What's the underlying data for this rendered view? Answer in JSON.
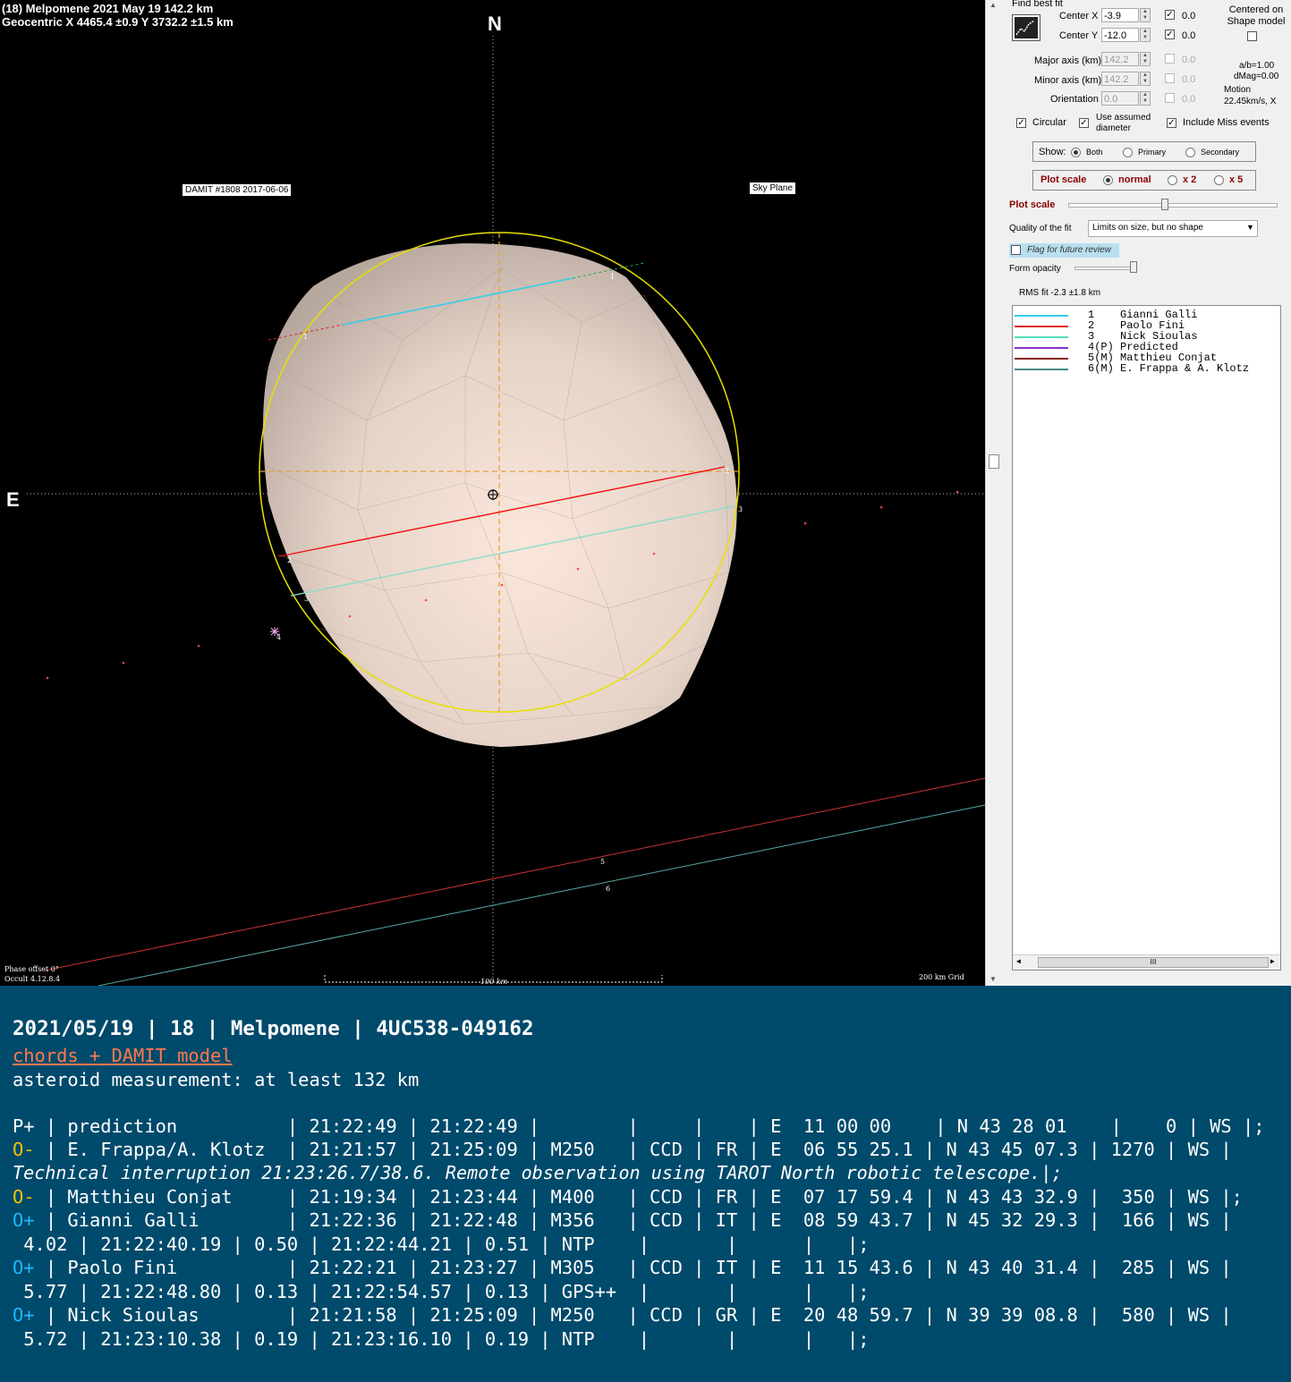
{
  "plot": {
    "header_line1": "(18) Melpomene  2021 May 19   142.2 km",
    "header_line2": "Geocentric X  4465.4 ±0.9  Y 3732.2 ±1.5 km",
    "north": "N",
    "east": "E",
    "model_label": "DAMIT #1808 2017-06-06",
    "view_label": "Sky Plane",
    "phase_offset": "Phase offset 0°",
    "version": "Occult 4.12.8.4",
    "scale_bar": "100 km",
    "grid": "200 km Grid",
    "chord_labels": [
      "1",
      "1",
      "2",
      "2",
      "3",
      "3",
      "4",
      "5",
      "6"
    ]
  },
  "panel": {
    "find_best_fit": "Find best fit",
    "center_x_label": "Center X",
    "center_x": "-3.9",
    "center_x_fix": "0.0",
    "center_y_label": "Center Y",
    "center_y": "-12.0",
    "center_y_fix": "0.0",
    "centered_label": "Centered on Shape model",
    "major_label": "Major axis (km)",
    "major": "142.2",
    "major_fix": "0.0",
    "minor_label": "Minor axis (km)",
    "minor": "142.2",
    "minor_fix": "0.0",
    "orient_label": "Orientation",
    "orient": "0.0",
    "orient_fix": "0.0",
    "ab": "a/b=1.00",
    "dmag": "dMag=0.00",
    "motion": "Motion",
    "motion_val": "22.45km/s, X",
    "circular": "Circular",
    "use_assumed": "Use assumed diameter",
    "include_miss": "Include Miss events",
    "show_label": "Show:",
    "show_both": "Both",
    "show_primary": "Primary",
    "show_secondary": "Secondary",
    "plot_scale_label": "Plot scale",
    "scale_normal": "normal",
    "scale_x2": "x 2",
    "scale_x5": "x 5",
    "plot_scale_slider_label": "Plot scale",
    "quality_label": "Quality of the fit",
    "quality_value": "Limits on size, but no shape",
    "flag_review": "Flag for future review",
    "form_opacity": "Form opacity",
    "rms_fit": "RMS fit -2.3 ±1.8 km",
    "legend": [
      {
        "num": "1",
        "name": "Gianni Galli",
        "color": "#33ccee"
      },
      {
        "num": "2",
        "name": "Paolo Fini",
        "color": "#dd2222"
      },
      {
        "num": "3",
        "name": "Nick Sioulas",
        "color": "#55ddbb"
      },
      {
        "num": "4(P)",
        "name": "Predicted",
        "color": "#8833cc"
      },
      {
        "num": "5(M)",
        "name": "Matthieu Conjat",
        "color": "#882222"
      },
      {
        "num": "6(M)",
        "name": "E. Frappa & A. Klotz",
        "color": "#448888"
      }
    ],
    "hscroll_thumb": "III"
  },
  "terminal": {
    "title": "2021/05/19 | 18 | Melpomene | 4UC538-049162",
    "link": "chords + DAMIT model",
    "measurement": "asteroid measurement: at least 132 km",
    "lines": [
      {
        "tag": "P+",
        "tag_color": "white",
        "text": " | prediction          | 21:22:49 | 21:22:49 |        |     |    | E  11 00 00    | N 43 28 01    |    0 | WS |;"
      },
      {
        "tag": "O-",
        "tag_color": "yellow",
        "text": " | E. Frappa/A. Klotz  | 21:21:57 | 21:25:09 | M250   | CCD | FR | E  06 55 25.1 | N 43 45 07.3 | 1270 | WS |"
      },
      {
        "tag": "",
        "tag_color": "italic",
        "text": "Technical interruption 21:23:26.7/38.6. Remote observation using TAROT North robotic telescope.|;"
      },
      {
        "tag": "O-",
        "tag_color": "yellow",
        "text": " | Matthieu Conjat     | 21:19:34 | 21:23:44 | M400   | CCD | FR | E  07 17 59.4 | N 43 43 32.9 |  350 | WS |;"
      },
      {
        "tag": "O+",
        "tag_color": "cyan",
        "text": " | Gianni Galli        | 21:22:36 | 21:22:48 | M356   | CCD | IT | E  08 59 43.7 | N 45 32 29.3 |  166 | WS |"
      },
      {
        "tag": "",
        "tag_color": "white",
        "text": " 4.02 | 21:22:40.19 | 0.50 | 21:22:44.21 | 0.51 | NTP    |       |      |   |;"
      },
      {
        "tag": "O+",
        "tag_color": "cyan",
        "text": " | Paolo Fini          | 21:22:21 | 21:23:27 | M305   | CCD | IT | E  11 15 43.6 | N 43 40 31.4 |  285 | WS |"
      },
      {
        "tag": "",
        "tag_color": "white",
        "text": " 5.77 | 21:22:48.80 | 0.13 | 21:22:54.57 | 0.13 | GPS++  |       |      |   |;"
      },
      {
        "tag": "O+",
        "tag_color": "cyan",
        "text": " | Nick Sioulas        | 21:21:58 | 21:25:09 | M250   | CCD | GR | E  20 48 59.7 | N 39 39 08.8 |  580 | WS |"
      },
      {
        "tag": "",
        "tag_color": "white",
        "text": " 5.72 | 21:23:10.38 | 0.19 | 21:23:16.10 | 0.19 | NTP    |       |      |   |;"
      }
    ]
  }
}
